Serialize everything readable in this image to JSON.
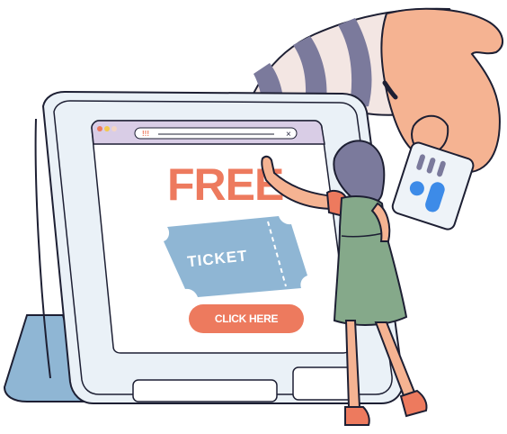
{
  "illustration": {
    "headline": "FREE",
    "ticket_label": "TICKET",
    "button_label": "CLICK HERE",
    "address_text": "!!!",
    "close_glyph": "×"
  },
  "colors": {
    "accent": "#ed7a5e",
    "ticket": "#8fb6d4",
    "tablet_frame": "#eaf1f7",
    "tablet_outline": "#1d1f33",
    "browser_bar": "#d9cde6",
    "dress": "#85a98a",
    "hair": "#7b7a9c",
    "skin": "#f5b392",
    "card_icon_blue": "#3d8be8"
  },
  "icons": [
    "window-dots-icon",
    "close-icon",
    "ticket-icon",
    "card-logo-icon"
  ]
}
